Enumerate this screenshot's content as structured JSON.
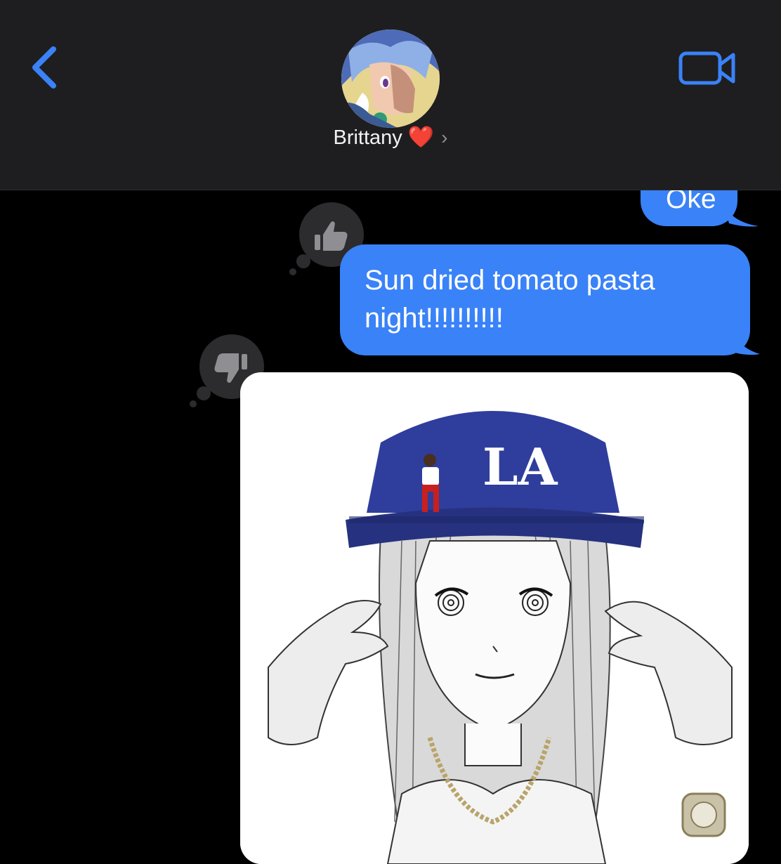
{
  "header": {
    "contact_name": "Brittany",
    "contact_emoji": "❤️",
    "chevron": "›",
    "back_icon": "chevron-left-icon",
    "video_icon": "video-camera-icon",
    "accent_color": "#3a82f7"
  },
  "messages": [
    {
      "id": "m1",
      "sender": "me",
      "text": "Oke"
    },
    {
      "id": "m2",
      "sender": "me",
      "text": "Sun dried tomato pasta night!!!!!!!!!!",
      "reaction": "thumbs-up-icon"
    },
    {
      "id": "m3",
      "sender": "me",
      "type": "image",
      "reaction": "thumbs-down-icon",
      "image_text": "LA"
    }
  ],
  "colors": {
    "bubble": "#3a82f7",
    "background": "#000000",
    "header_bg": "#1e1e20",
    "tapback_bg": "#2c2c2e"
  }
}
